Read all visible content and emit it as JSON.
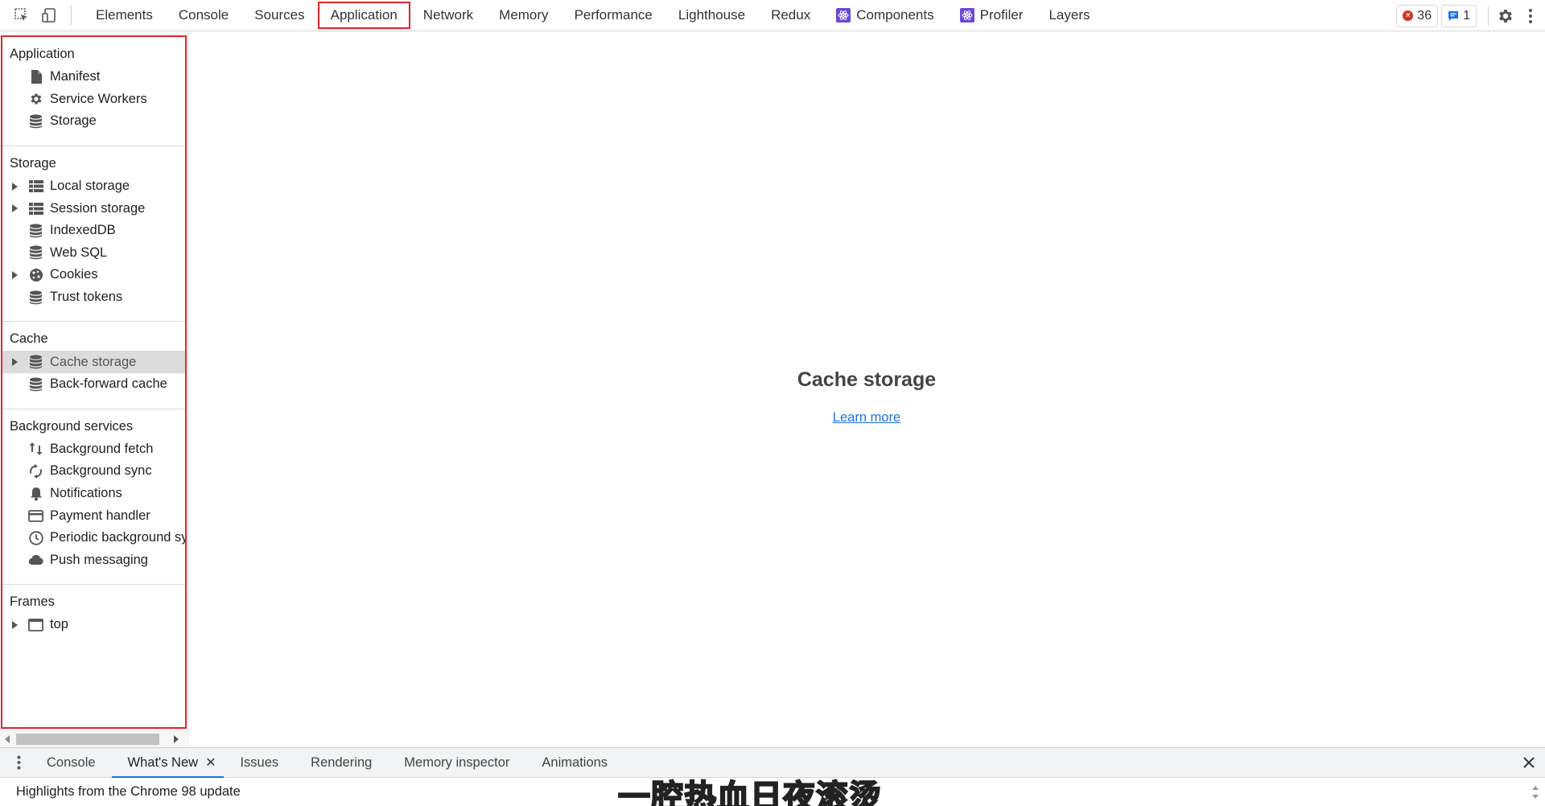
{
  "toolbar": {
    "tabs": [
      "Elements",
      "Console",
      "Sources",
      "Application",
      "Network",
      "Memory",
      "Performance",
      "Lighthouse",
      "Redux",
      "Components",
      "Profiler",
      "Layers"
    ],
    "selected_tab": "Application",
    "error_count": "36",
    "message_count": "1"
  },
  "sidebar": {
    "sections": [
      {
        "title": "Application",
        "items": [
          {
            "label": "Manifest",
            "icon": "file-icon",
            "expandable": false
          },
          {
            "label": "Service Workers",
            "icon": "gear-icon",
            "expandable": false
          },
          {
            "label": "Storage",
            "icon": "database-icon",
            "expandable": false
          }
        ]
      },
      {
        "title": "Storage",
        "items": [
          {
            "label": "Local storage",
            "icon": "grid-icon",
            "expandable": true
          },
          {
            "label": "Session storage",
            "icon": "grid-icon",
            "expandable": true
          },
          {
            "label": "IndexedDB",
            "icon": "database-icon",
            "expandable": false
          },
          {
            "label": "Web SQL",
            "icon": "database-icon",
            "expandable": false
          },
          {
            "label": "Cookies",
            "icon": "cookie-icon",
            "expandable": true
          },
          {
            "label": "Trust tokens",
            "icon": "database-icon",
            "expandable": false
          }
        ]
      },
      {
        "title": "Cache",
        "items": [
          {
            "label": "Cache storage",
            "icon": "database-icon",
            "expandable": true,
            "selected": true
          },
          {
            "label": "Back-forward cache",
            "icon": "database-icon",
            "expandable": false
          }
        ]
      },
      {
        "title": "Background services",
        "items": [
          {
            "label": "Background fetch",
            "icon": "up-down-arrows-icon",
            "expandable": false
          },
          {
            "label": "Background sync",
            "icon": "sync-icon",
            "expandable": false
          },
          {
            "label": "Notifications",
            "icon": "bell-icon",
            "expandable": false
          },
          {
            "label": "Payment handler",
            "icon": "card-icon",
            "expandable": false
          },
          {
            "label": "Periodic background sy",
            "icon": "clock-icon",
            "expandable": false
          },
          {
            "label": "Push messaging",
            "icon": "cloud-icon",
            "expandable": false
          }
        ]
      },
      {
        "title": "Frames",
        "items": [
          {
            "label": "top",
            "icon": "frame-icon",
            "expandable": true
          }
        ]
      }
    ]
  },
  "main": {
    "title": "Cache storage",
    "link": "Learn more"
  },
  "drawer": {
    "tabs": [
      "Console",
      "What's New",
      "Issues",
      "Rendering",
      "Memory inspector",
      "Animations"
    ],
    "active_tab": "What's New",
    "body_text": "Highlights from the Chrome 98 update"
  },
  "caption": "一腔热血日夜滚烫",
  "colors": {
    "highlight": "#e0242c",
    "link": "#1a73e8",
    "selected_row": "#dcdcdc",
    "react_badge": "#6c47d6"
  }
}
